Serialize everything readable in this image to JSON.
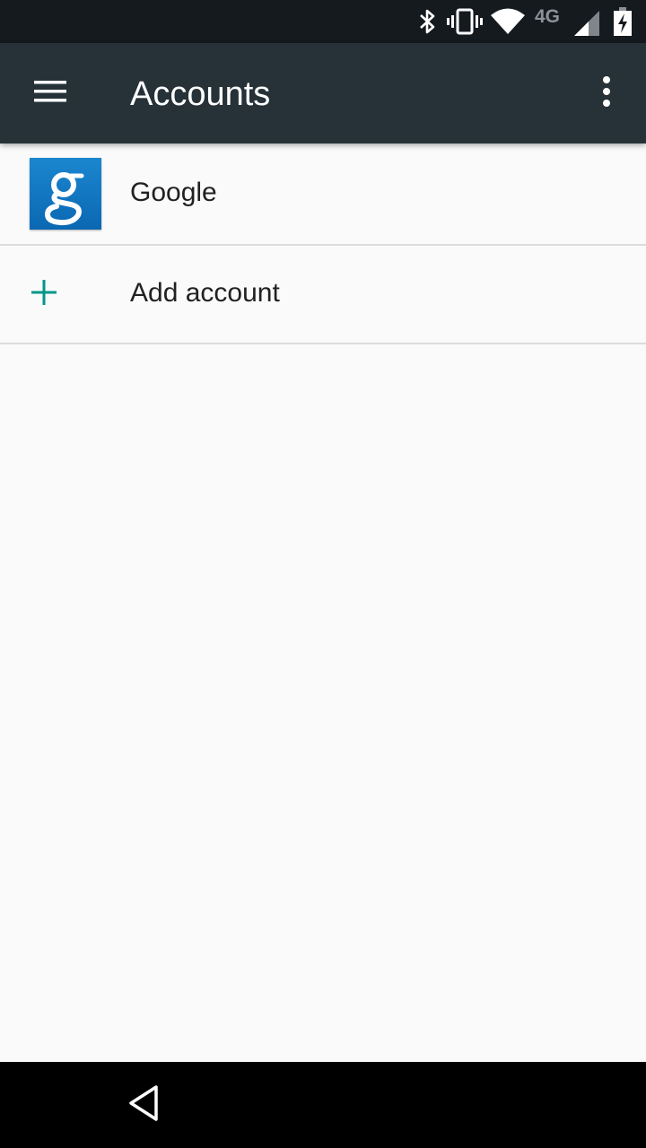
{
  "status_bar": {
    "network_label": "4G",
    "icons": [
      "bluetooth-icon",
      "vibrate-icon",
      "wifi-icon",
      "cell-signal-icon",
      "battery-charging-icon"
    ]
  },
  "toolbar": {
    "title": "Accounts",
    "menu_icon": "hamburger-menu-icon",
    "overflow_icon": "more-vert-icon",
    "background": "#263238"
  },
  "accounts": [
    {
      "label": "Google",
      "icon": "google-logo-icon"
    }
  ],
  "add_account": {
    "label": "Add account",
    "icon": "plus-icon",
    "icon_color": "#009688"
  },
  "nav_bar": {
    "back_icon": "back-triangle-icon"
  }
}
